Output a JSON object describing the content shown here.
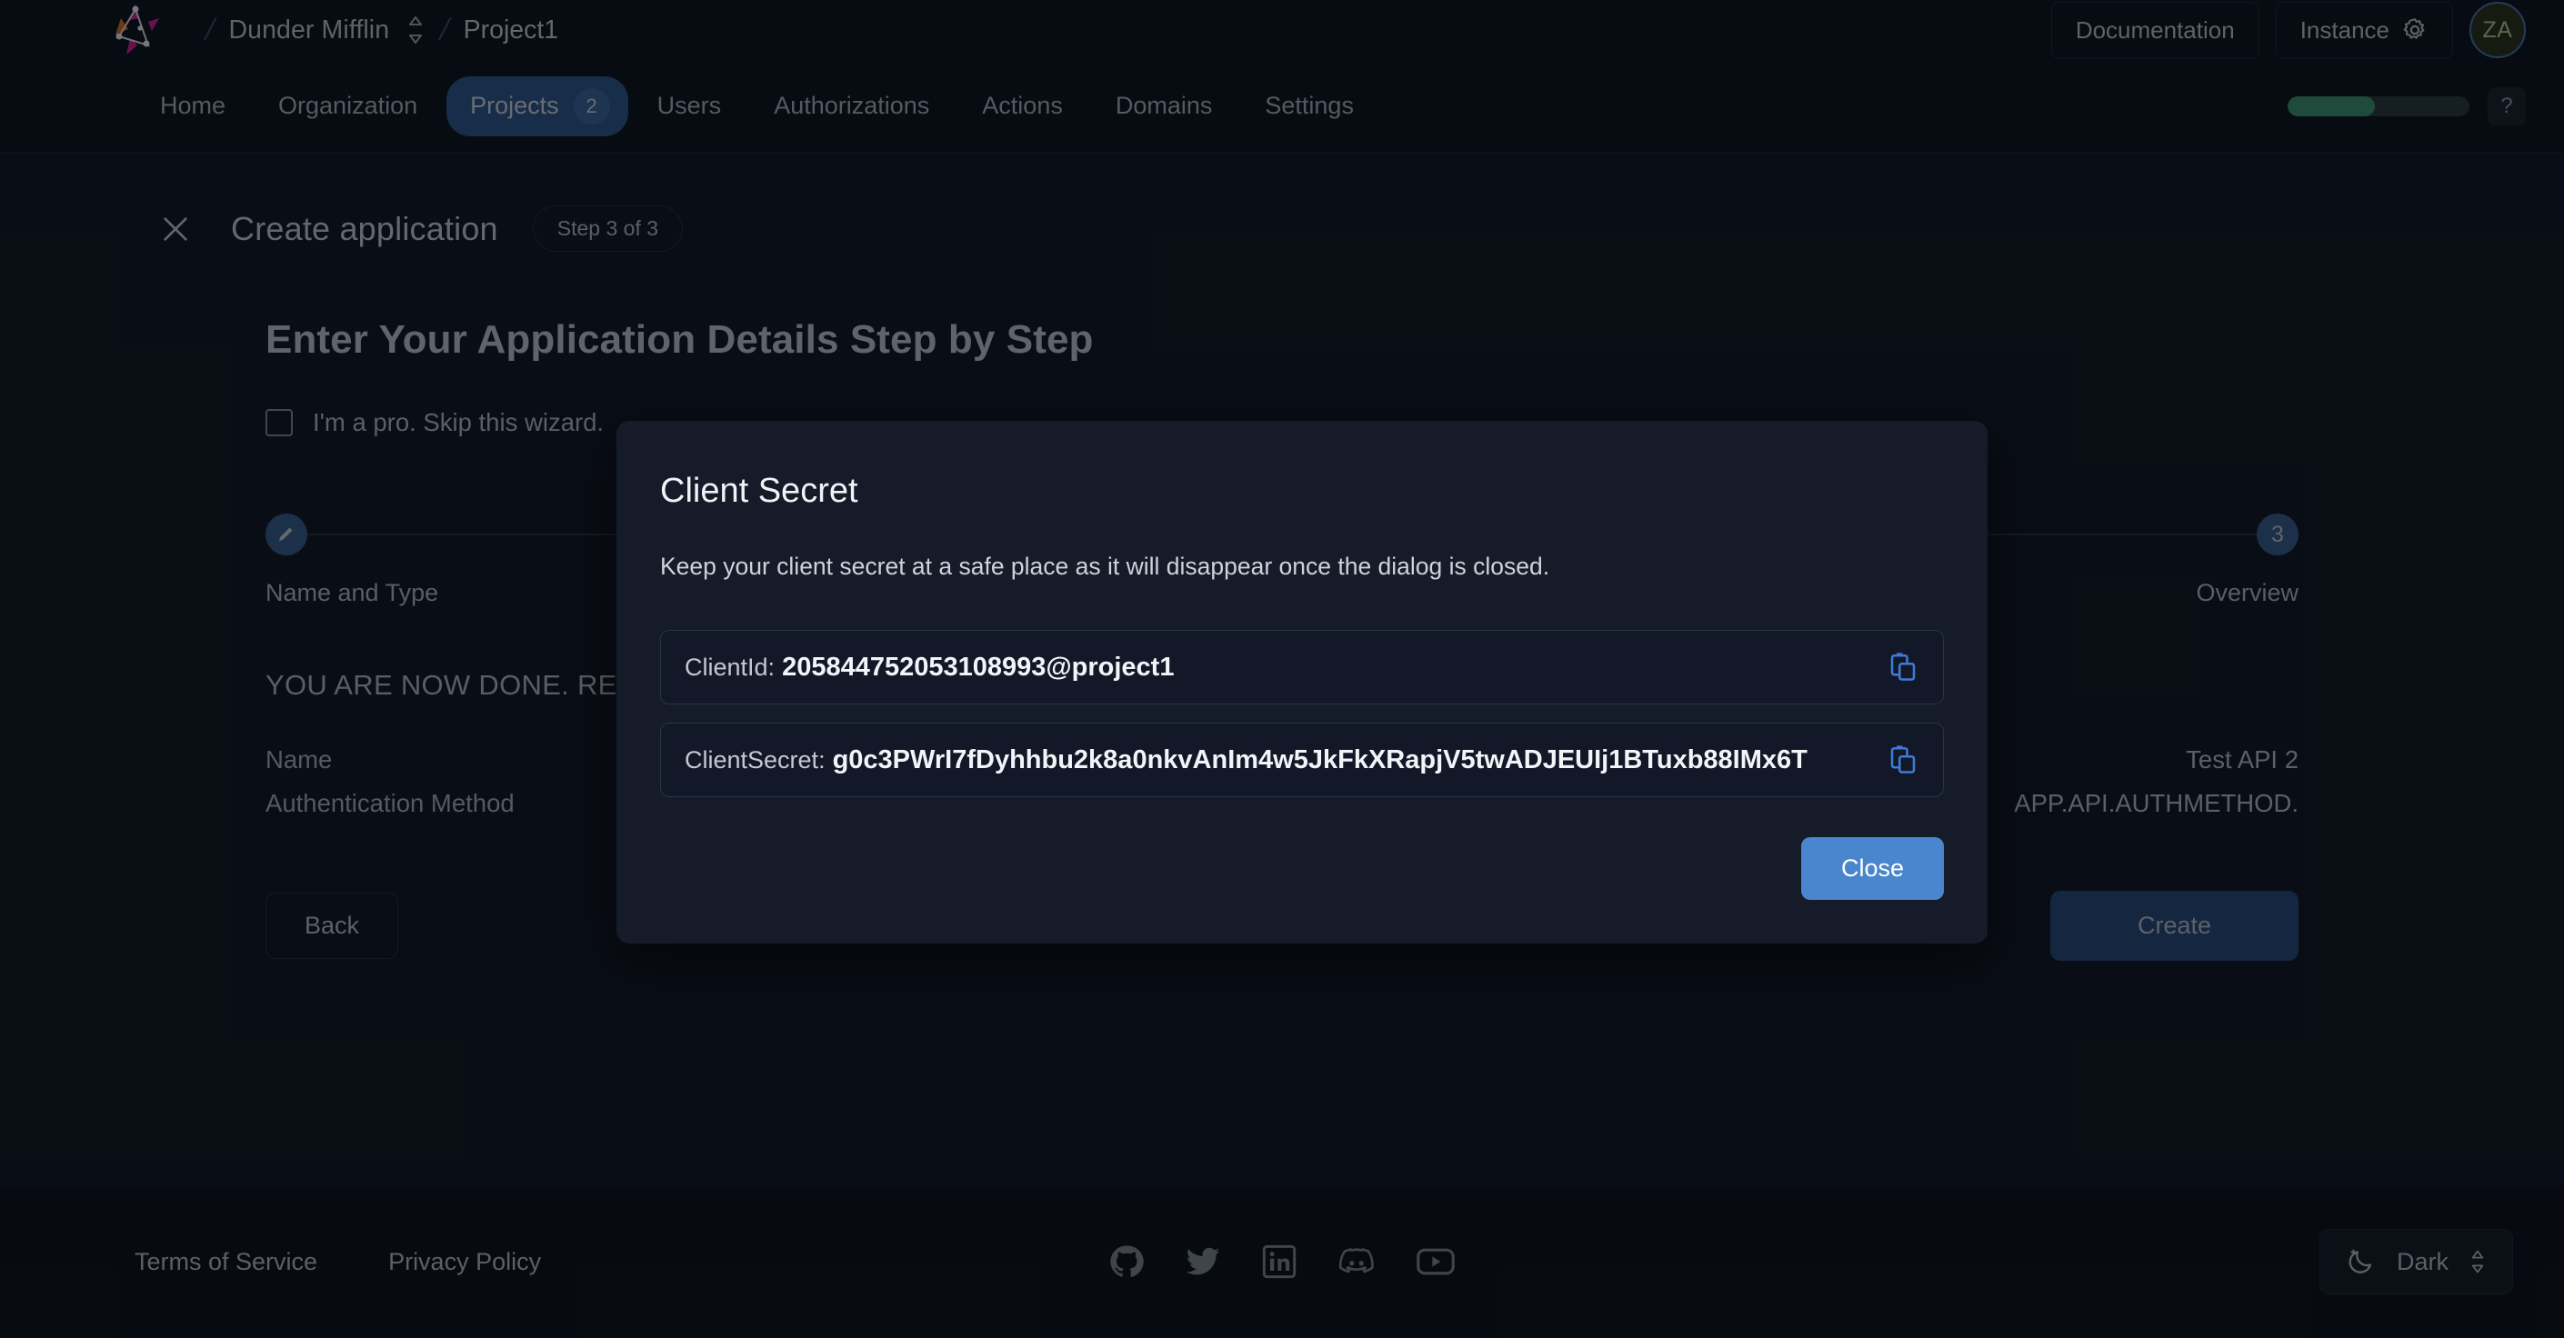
{
  "header": {
    "org_name": "Dunder Mifflin",
    "project_name": "Project1",
    "documentation_label": "Documentation",
    "instance_label": "Instance",
    "avatar_initials": "ZA"
  },
  "nav": {
    "items": [
      {
        "label": "Home",
        "badge": "",
        "active": false
      },
      {
        "label": "Organization",
        "badge": "",
        "active": false
      },
      {
        "label": "Projects",
        "badge": "2",
        "active": true
      },
      {
        "label": "Users",
        "badge": "",
        "active": false
      },
      {
        "label": "Authorizations",
        "badge": "",
        "active": false
      },
      {
        "label": "Actions",
        "badge": "",
        "active": false
      },
      {
        "label": "Domains",
        "badge": "",
        "active": false
      },
      {
        "label": "Settings",
        "badge": "",
        "active": false
      }
    ],
    "progress_percent": 48,
    "help_label": "?"
  },
  "wizard": {
    "title": "Create application",
    "step_badge": "Step 3 of 3",
    "heading": "Enter Your Application Details Step by Step",
    "skip_label": "I'm a pro. Skip this wizard.",
    "steps": [
      {
        "marker": "✎",
        "label": "Name and Type"
      },
      {
        "marker": "3",
        "label": "Overview"
      }
    ],
    "summary_title": "YOU ARE NOW DONE. REVIEW YOUR DATA",
    "summary_rows": [
      {
        "key": "Name",
        "value": "Test API 2"
      },
      {
        "key": "Authentication Method",
        "value": "APP.API.AUTHMETHOD."
      }
    ],
    "back_label": "Back",
    "create_label": "Create"
  },
  "modal": {
    "title": "Client Secret",
    "description": "Keep your client secret at a safe place as it will disappear once the dialog is closed.",
    "client_id_label": "ClientId:",
    "client_id_value": "205844752053108993@project1",
    "client_secret_label": "ClientSecret:",
    "client_secret_value": "g0c3PWrI7fDyhhbu2k8a0nkvAnIm4w5JkFkXRapjV5twADJEUIj1BTuxb88IMx6T",
    "close_label": "Close"
  },
  "footer": {
    "terms_label": "Terms of Service",
    "privacy_label": "Privacy Policy",
    "social": [
      "github-icon",
      "twitter-icon",
      "linkedin-icon",
      "discord-icon",
      "youtube-icon"
    ],
    "theme_label": "Dark"
  },
  "colors": {
    "accent": "#4a86cd",
    "nav_active": "#2f5b94",
    "create_button": "#2b4d82",
    "progress": "#3f9e72",
    "page_bg": "#11161f",
    "modal_bg": "#151b29"
  }
}
